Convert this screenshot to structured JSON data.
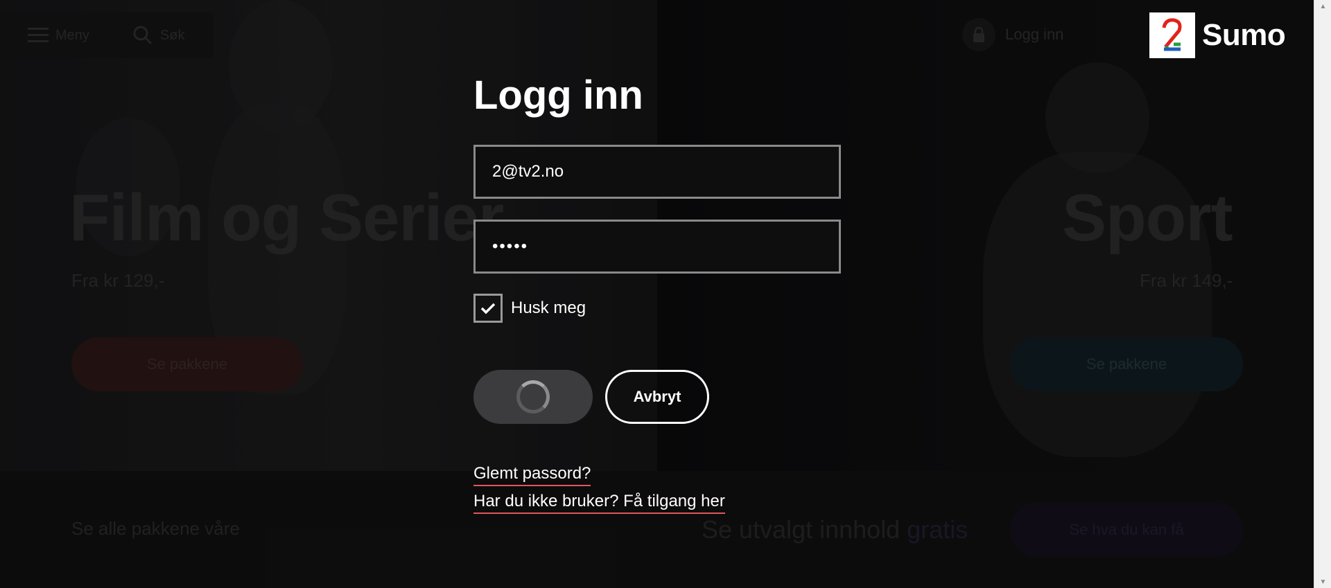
{
  "background": {
    "menu_label": "Meny",
    "search_label": "Søk",
    "login_label": "Logg inn",
    "left": {
      "title": "Film og Serier",
      "price": "Fra kr 129,-",
      "cta": "Se pakkene"
    },
    "right": {
      "title": "Sport",
      "price": "Fra kr 149,-",
      "cta": "Se pakkene"
    },
    "bottom": {
      "all_packages": "Se alle pakkene våre",
      "free_text": "Se utvalgt innhold",
      "free_highlight": "gratis",
      "free_cta": "Se hva du kan få"
    }
  },
  "logo": {
    "text": "Sumo"
  },
  "login": {
    "title": "Logg inn",
    "email_value": "2@tv2.no",
    "password_value": "•••••",
    "remember_label": "Husk meg",
    "remember_checked": true,
    "cancel_label": "Avbryt",
    "forgot_link": "Glemt passord?",
    "register_link": "Har du ikke bruker? Få tilgang her"
  },
  "colors": {
    "link_underline": "#e2575c",
    "accent_left": "#7a2a2a",
    "accent_right": "#1e3a44"
  }
}
